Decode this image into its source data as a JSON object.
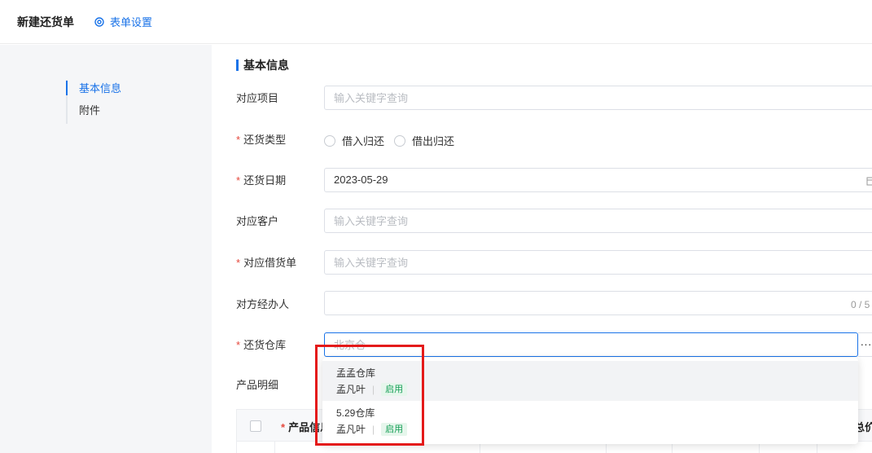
{
  "header": {
    "title": "新建还货单",
    "settings_label": "表单设置"
  },
  "sidebar": {
    "items": [
      {
        "label": "基本信息",
        "active": true
      },
      {
        "label": "附件",
        "active": false
      }
    ]
  },
  "form": {
    "section_title": "基本信息",
    "fields": {
      "project": {
        "label": "对应项目",
        "placeholder": "输入关键字查询",
        "value": ""
      },
      "return_type": {
        "label": "还货类型",
        "required": true,
        "options": [
          "借入归还",
          "借出归还"
        ]
      },
      "return_date": {
        "label": "还货日期",
        "required": true,
        "value": "2023-05-29"
      },
      "customer": {
        "label": "对应客户",
        "placeholder": "输入关键字查询",
        "value": ""
      },
      "loan_order": {
        "label": "对应借货单",
        "required": true,
        "placeholder": "输入关键字查询",
        "value": ""
      },
      "handler": {
        "label": "对方经办人",
        "value": "",
        "counter": "0 / 5"
      },
      "warehouse": {
        "label": "还货仓库",
        "required": true,
        "placeholder": "北京仓",
        "value": "",
        "more": "···"
      }
    },
    "detail_label": "产品明细",
    "table": {
      "columns": [
        "产品信息",
        "总价"
      ]
    }
  },
  "warehouse_dropdown": {
    "options": [
      {
        "name": "孟孟仓库",
        "manager": "孟凡叶",
        "status": "启用"
      },
      {
        "name": "5.29仓库",
        "manager": "孟凡叶",
        "status": "启用"
      }
    ]
  },
  "colors": {
    "accent": "#1a73e8",
    "required": "#e5483d",
    "status_ok": "#18a058",
    "annotation": "#e41a1a"
  }
}
